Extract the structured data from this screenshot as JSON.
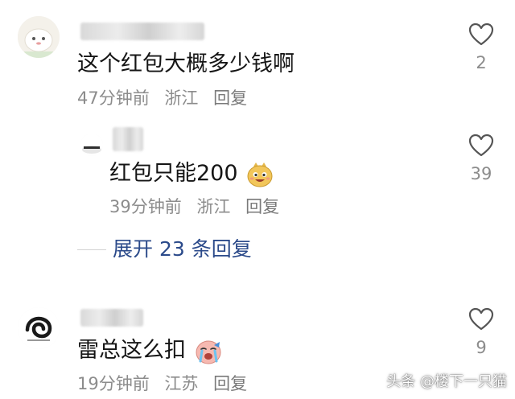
{
  "comments": [
    {
      "text": "这个红包大概多少钱啊",
      "time": "47分钟前",
      "location": "浙江",
      "reply_label": "回复",
      "likes": "2"
    },
    {
      "text": "红包只能200",
      "emoji": "smiling-cartoon-face-emoji",
      "time": "39分钟前",
      "location": "浙江",
      "reply_label": "回复",
      "likes": "39"
    },
    {
      "text": "雷总这么扣",
      "emoji": "crying-cartoon-face-emoji",
      "time": "19分钟前",
      "location": "江苏",
      "reply_label": "回复",
      "likes": "9"
    }
  ],
  "expand_replies": {
    "label": "展开 23 条回复"
  },
  "watermark": {
    "text": "头条 @楼下一只猫"
  },
  "colors": {
    "text": "#151515",
    "meta": "#8c8c8c",
    "link": "#2b4a8a",
    "background": "#ffffff"
  },
  "icons": {
    "like": "heart-outline-icon"
  }
}
